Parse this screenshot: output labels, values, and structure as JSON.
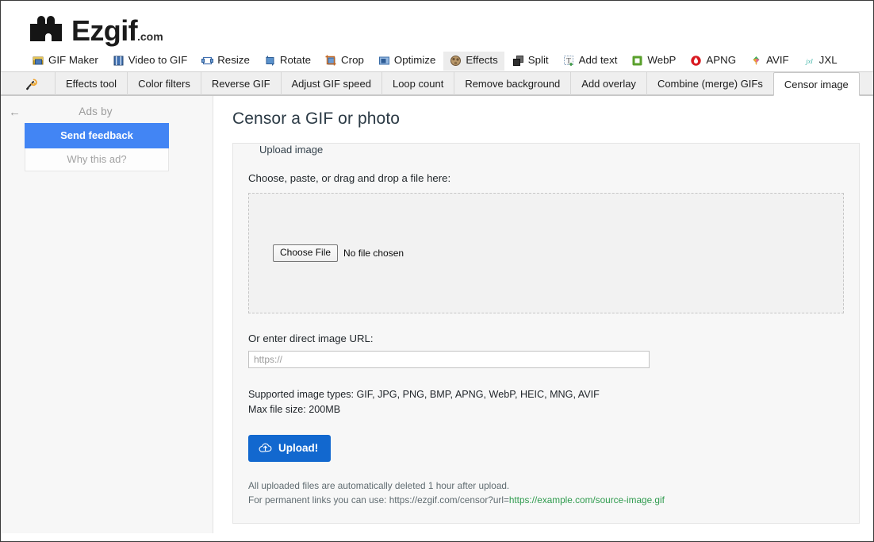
{
  "brand": {
    "name": "Ezgif",
    "tld": ".com"
  },
  "main_nav": [
    {
      "label": "GIF Maker",
      "icon": "gif-maker-icon",
      "active": false
    },
    {
      "label": "Video to GIF",
      "icon": "video-to-gif-icon",
      "active": false
    },
    {
      "label": "Resize",
      "icon": "resize-icon",
      "active": false
    },
    {
      "label": "Rotate",
      "icon": "rotate-icon",
      "active": false
    },
    {
      "label": "Crop",
      "icon": "crop-icon",
      "active": false
    },
    {
      "label": "Optimize",
      "icon": "optimize-icon",
      "active": false
    },
    {
      "label": "Effects",
      "icon": "effects-icon",
      "active": true
    },
    {
      "label": "Split",
      "icon": "split-icon",
      "active": false
    },
    {
      "label": "Add text",
      "icon": "add-text-icon",
      "active": false
    },
    {
      "label": "WebP",
      "icon": "webp-icon",
      "active": false
    },
    {
      "label": "APNG",
      "icon": "apng-icon",
      "active": false
    },
    {
      "label": "AVIF",
      "icon": "avif-icon",
      "active": false
    },
    {
      "label": "JXL",
      "icon": "jxl-icon",
      "active": false
    }
  ],
  "sub_nav": [
    {
      "label": "Effects tool",
      "active": false
    },
    {
      "label": "Color filters",
      "active": false
    },
    {
      "label": "Reverse GIF",
      "active": false
    },
    {
      "label": "Adjust GIF speed",
      "active": false
    },
    {
      "label": "Loop count",
      "active": false
    },
    {
      "label": "Remove background",
      "active": false
    },
    {
      "label": "Add overlay",
      "active": false
    },
    {
      "label": "Combine (merge) GIFs",
      "active": false
    },
    {
      "label": "Censor image",
      "active": true
    }
  ],
  "sidebar": {
    "ads_by_label": "Ads by",
    "send_feedback_label": "Send feedback",
    "why_this_ad_label": "Why this ad?",
    "back_arrow": "←"
  },
  "main": {
    "page_title": "Censor a GIF or photo",
    "fieldset_legend": "Upload image",
    "choose_label": "Choose, paste, or drag and drop a file here:",
    "file_button_label": "Choose File",
    "file_status_text": "No file chosen",
    "url_label": "Or enter direct image URL:",
    "url_placeholder": "https://",
    "url_value": "",
    "supported_types": "Supported image types: GIF, JPG, PNG, BMP, APNG, WebP, HEIC, MNG, AVIF",
    "max_file_size": "Max file size: 200MB",
    "upload_button_label": "Upload!",
    "note_line1": "All uploaded files are automatically deleted 1 hour after upload.",
    "note_line2_prefix": "For permanent links you can use: https://ezgif.com/censor?url=",
    "note_line2_link": "https://example.com/source-image.gif"
  },
  "colors": {
    "accent_blue": "#1268cf",
    "ad_blue": "#4285f4",
    "link_green": "#2f9b4e",
    "active_tab_bg": "#ffffff",
    "tabbar_bg": "#efefef"
  }
}
